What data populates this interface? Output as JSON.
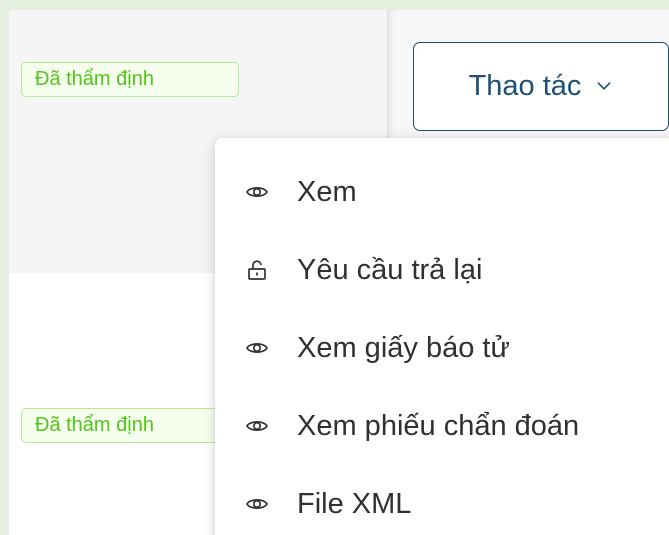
{
  "rows": [
    {
      "status_badge": "Đã thẩm định"
    },
    {
      "status_badge": "Đã thẩm định"
    }
  ],
  "actions": {
    "button_label": "Thao tác",
    "menu_items": [
      {
        "label": "Xem",
        "icon": "eye-icon"
      },
      {
        "label": "Yêu cầu trả lại",
        "icon": "unlock-icon"
      },
      {
        "label": "Xem giấy báo tử",
        "icon": "eye-icon"
      },
      {
        "label": "Xem phiếu chẩn đoán",
        "icon": "eye-icon"
      },
      {
        "label": "File XML",
        "icon": "eye-icon"
      }
    ]
  },
  "colors": {
    "badge_text": "#52c41a",
    "badge_border": "#b7eb8f",
    "badge_bg": "#f6ffed",
    "button_border": "#1f4f73",
    "page_bg": "#e4efdf"
  }
}
